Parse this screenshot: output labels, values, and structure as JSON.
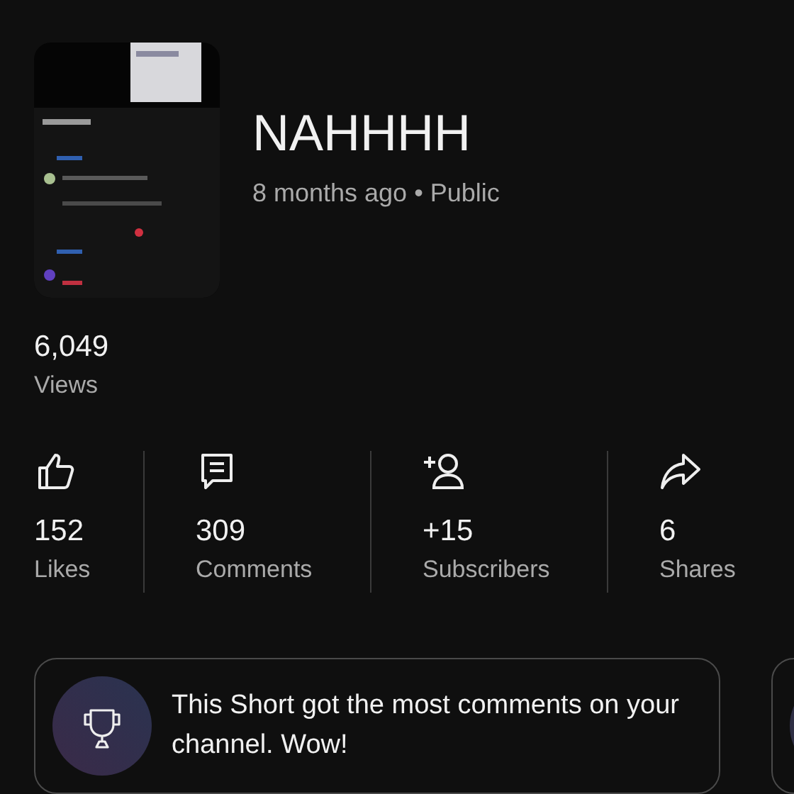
{
  "video": {
    "title": "NAHHHH",
    "meta": "8 months ago • Public"
  },
  "views": {
    "value": "6,049",
    "label": "Views"
  },
  "stats": [
    {
      "kind": "likes",
      "value": "152",
      "label": "Likes"
    },
    {
      "kind": "comments",
      "value": "309",
      "label": "Comments"
    },
    {
      "kind": "subscribers",
      "value": "+15",
      "label": "Subscribers"
    },
    {
      "kind": "shares",
      "value": "6",
      "label": "Shares"
    }
  ],
  "insights": [
    {
      "kind": "trophy",
      "text": "This Short got the most comments on your channel. Wow!"
    },
    {
      "kind": "partial"
    }
  ]
}
